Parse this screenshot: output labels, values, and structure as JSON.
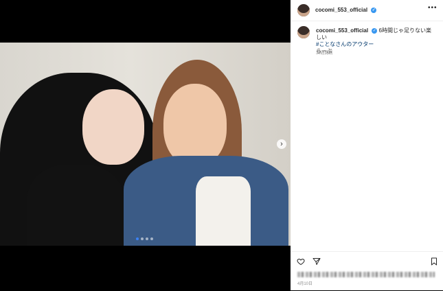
{
  "post": {
    "username": "cocomi_553_official",
    "verified_symbol": "✓",
    "caption_text": "6時間じゃ足りない楽しい",
    "caption_hashtag": "#ことなさんのアウター",
    "caption_end": "らーぶ",
    "time_ago": "30週間前",
    "date": "4月10日"
  },
  "carousel": {
    "next_symbol": "›",
    "current_index": 1,
    "total": 4
  },
  "header": {
    "more_symbol": "•••"
  }
}
